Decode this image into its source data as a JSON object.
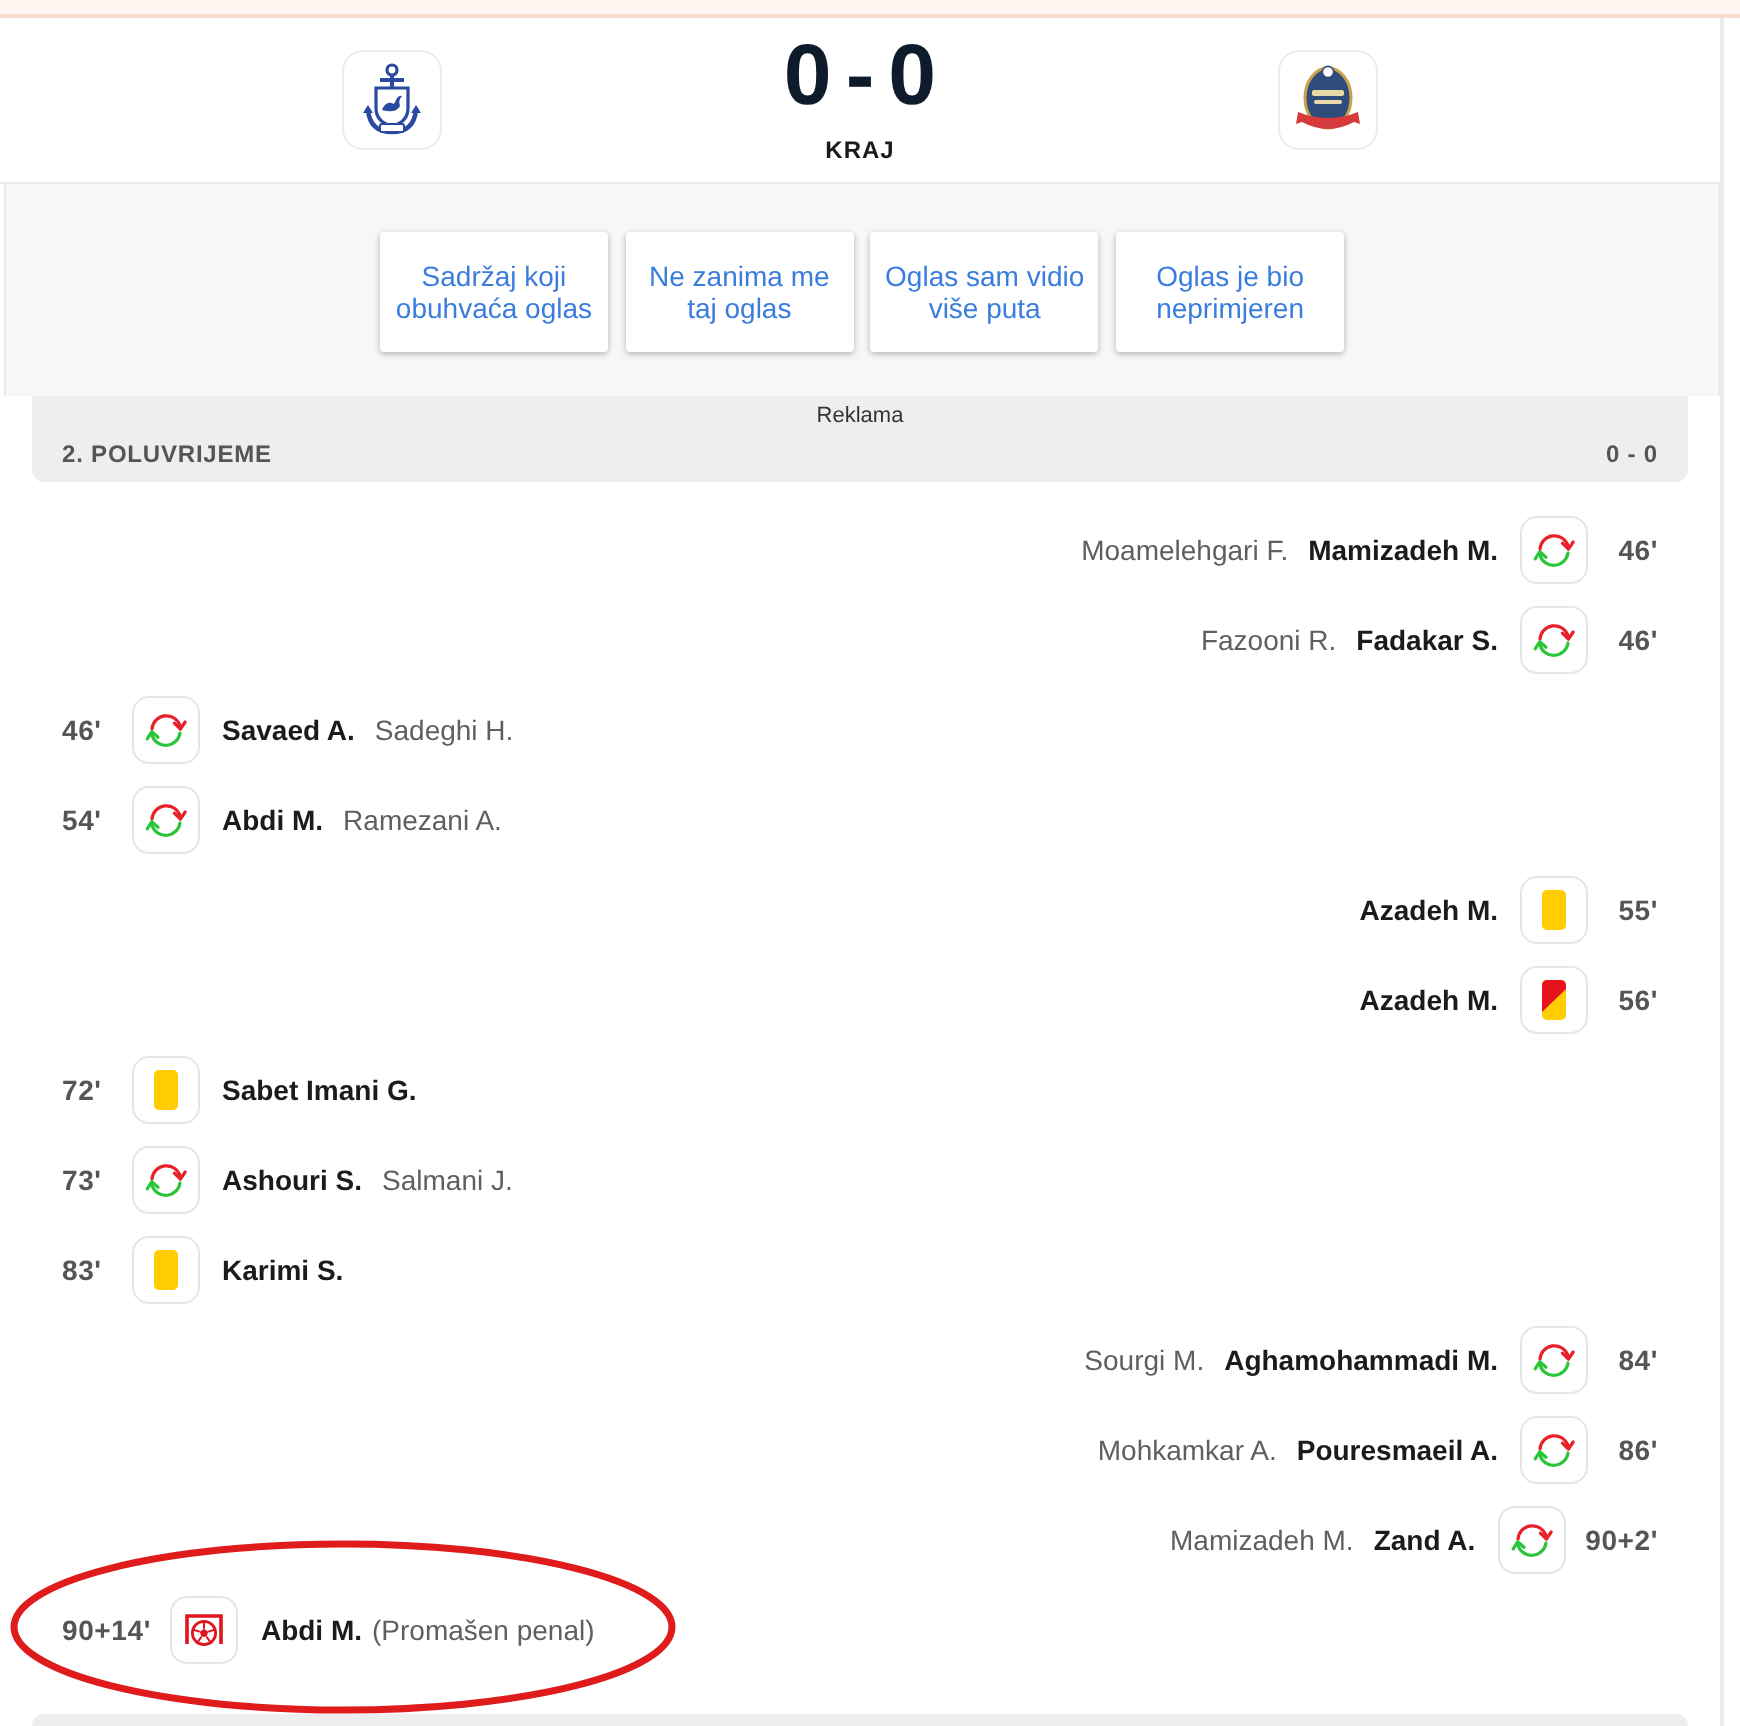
{
  "score": {
    "home": "0",
    "separator": "-",
    "away": "0",
    "status": "KRAJ"
  },
  "ad_feedback": {
    "options": [
      "Sadržaj koji obuhvaća oglas",
      "Ne zanima me taj oglas",
      "Oglas sam vidio više puta",
      "Oglas je bio neprimjeren"
    ],
    "label": "Reklama"
  },
  "period": {
    "title": "2. POLUVRIJEME",
    "score": "0 - 0"
  },
  "events": [
    {
      "away": true,
      "time": "46'",
      "kind": "substitution",
      "player": "Mamizadeh M.",
      "secondary": "Moamelehgari F.",
      "highlighted": false
    },
    {
      "away": true,
      "time": "46'",
      "kind": "substitution",
      "player": "Fadakar S.",
      "secondary": "Fazooni R.",
      "highlighted": false
    },
    {
      "away": false,
      "time": "46'",
      "kind": "substitution",
      "player": "Savaed A.",
      "secondary": "Sadeghi H.",
      "highlighted": false
    },
    {
      "away": false,
      "time": "54'",
      "kind": "substitution",
      "player": "Abdi M.",
      "secondary": "Ramezani A.",
      "highlighted": false
    },
    {
      "away": true,
      "time": "55'",
      "kind": "yellow_card",
      "player": "Azadeh M.",
      "highlighted": false
    },
    {
      "away": true,
      "time": "56'",
      "kind": "second_yellow",
      "player": "Azadeh M.",
      "highlighted": false
    },
    {
      "away": false,
      "time": "72'",
      "kind": "yellow_card",
      "player": "Sabet Imani G.",
      "highlighted": false
    },
    {
      "away": false,
      "time": "73'",
      "kind": "substitution",
      "player": "Ashouri S.",
      "secondary": "Salmani J.",
      "highlighted": false
    },
    {
      "away": false,
      "time": "83'",
      "kind": "yellow_card",
      "player": "Karimi S.",
      "highlighted": false
    },
    {
      "away": true,
      "time": "84'",
      "kind": "substitution",
      "player": "Aghamohammadi M.",
      "secondary": "Sourgi M.",
      "highlighted": false
    },
    {
      "away": true,
      "time": "86'",
      "kind": "substitution",
      "player": "Pouresmaeil A.",
      "secondary": "Mohkamkar A.",
      "highlighted": false
    },
    {
      "away": true,
      "time": "90+2'",
      "kind": "substitution",
      "player": "Zand A.",
      "secondary": "Mamizadeh M.",
      "highlighted": false
    },
    {
      "away": false,
      "time": "90+14'",
      "kind": "missed_penalty",
      "player": "Abdi M.",
      "note": "(Promašen penal)",
      "highlighted": true
    }
  ]
}
